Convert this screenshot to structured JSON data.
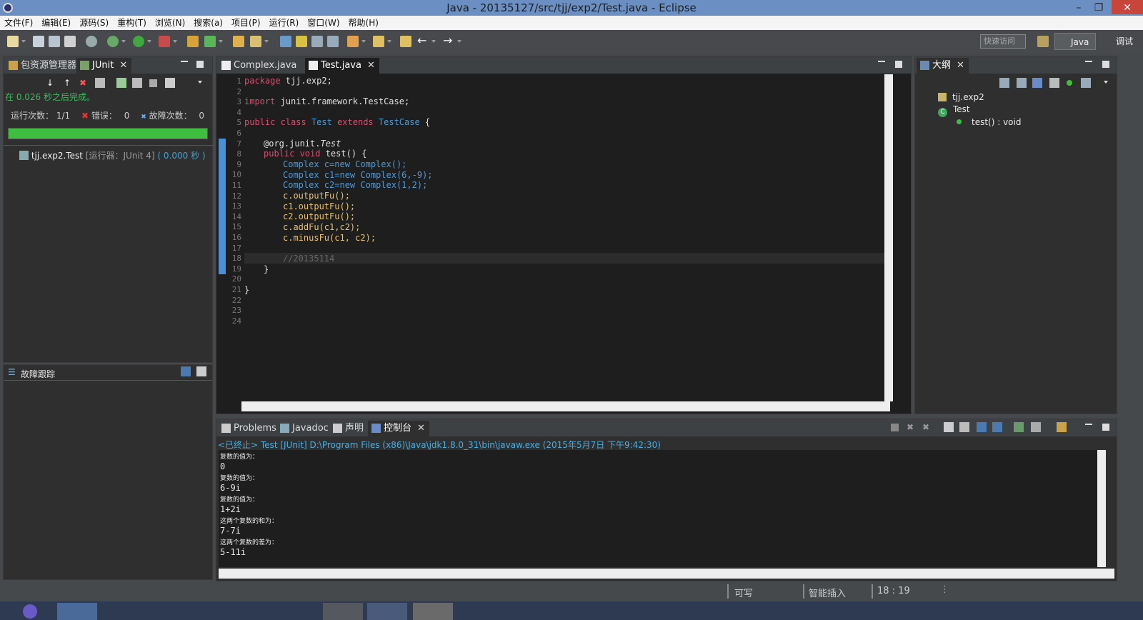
{
  "window": {
    "title": "Java - 20135127/src/tjj/exp2/Test.java - Eclipse"
  },
  "menu": [
    "文件(F)",
    "编辑(E)",
    "源码(S)",
    "重构(T)",
    "浏览(N)",
    "搜索(a)",
    "项目(P)",
    "运行(R)",
    "窗口(W)",
    "帮助(H)"
  ],
  "toolbar": {
    "quick_access": "快速访问",
    "perspectives": [
      "Java",
      "调试"
    ]
  },
  "left_panel": {
    "tabs": [
      "包资源管理器",
      "JUnit"
    ],
    "finished_text": "在 0.026 秒之后完成。",
    "runs_label": "运行次数：",
    "runs_value": "1/1",
    "errors_label": "错误：",
    "errors_value": "0",
    "failures_label": "故障次数：",
    "failures_value": "0",
    "progress": 1.0,
    "progress_color": "#3fbf3f",
    "tree_item": "tjj.exp2.Test",
    "tree_runner": "[运行器：JUnit 4]",
    "tree_time": "( 0.000 秒 )",
    "trace_title": "故障跟踪"
  },
  "editor": {
    "tabs": [
      "Complex.java",
      "Test.java"
    ],
    "line_numbers": [
      "1",
      "2",
      "3",
      "4",
      "5",
      "6",
      "7",
      "8",
      "9",
      "10",
      "11",
      "12",
      "13",
      "14",
      "15",
      "16",
      "17",
      "18",
      "19",
      "20",
      "21",
      "22",
      "23",
      "24"
    ],
    "code": {
      "l1_kw": "package",
      "l1_rest": " tjj.exp2;",
      "l3_kw": "import",
      "l3_rest": " junit.framework.TestCase;",
      "l5_kw1": "public class",
      "l5_name": "Test",
      "l5_kw2": "extends",
      "l5_type": "TestCase",
      "l5_brace": " {",
      "l7_at": "@org.junit.",
      "l7_test": "Test",
      "l8_kw": "public void",
      "l8_rest": " test() {",
      "l9": "Complex c=new Complex();",
      "l10": "Complex c1=new Complex(6,-9);",
      "l11": "Complex c2=new Complex(1,2);",
      "l12": "c.outputFu();",
      "l13": "c1.outputFu();",
      "l14": "c2.outputFu();",
      "l15": "c.addFu(c1,c2);",
      "l16": "c.minusFu(c1, c2);",
      "l18": "//20135114",
      "l19": "}",
      "l21": "}"
    }
  },
  "outline": {
    "tab": "大纲",
    "package": "tjj.exp2",
    "class": "Test",
    "method": "test() : void"
  },
  "bottom": {
    "tabs": [
      "Problems",
      "Javadoc",
      "声明",
      "控制台"
    ],
    "header": "<已终止> Test [JUnit] D:\\Program Files (x86)\\Java\\jdk1.8.0_31\\bin\\javaw.exe (2015年5月7日 下午9:42:30)",
    "lines": [
      "复数的值为：",
      "0",
      "复数的值为：",
      "6-9i",
      "复数的值为：",
      "1+2i",
      "这两个复数的和为：",
      "7-7i",
      "这两个复数的差为：",
      "5-11i"
    ]
  },
  "status": {
    "writable": "可写",
    "insert": "智能插入",
    "position": "18 : 19"
  }
}
